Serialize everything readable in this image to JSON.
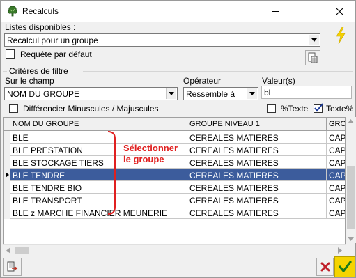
{
  "window": {
    "title": "Recalculs"
  },
  "listes": {
    "label": "Listes disponibles :",
    "selected": "Recalcul pour un groupe",
    "default_query_label": "Requête par défaut"
  },
  "criteria": {
    "group_label": "Critères de filtre",
    "field_label": "Sur le champ",
    "field_value": "NOM DU GROUPE",
    "operator_label": "Opérateur",
    "operator_value": "Ressemble à",
    "value_label": "Valeur(s)",
    "value_text": "bl",
    "case_label": "Différencier Minuscules / Majuscules",
    "pct_text_label": "%Texte",
    "text_pct_label": "Texte%",
    "text_pct_checked": true
  },
  "grid": {
    "columns": [
      "NOM DU GROUPE",
      "GROUPE NIVEAU 1",
      "GRO"
    ],
    "rows": [
      [
        "BLE",
        "CEREALES MATIERES",
        "CAP"
      ],
      [
        "BLE PRESTATION",
        "CEREALES MATIERES",
        "CAP"
      ],
      [
        "BLE STOCKAGE TIERS",
        "CEREALES MATIERES",
        "CAP"
      ],
      [
        "BLE TENDRE",
        "CEREALES MATIERES",
        "CAP"
      ],
      [
        "BLE TENDRE BIO",
        "CEREALES MATIERES",
        "CAP"
      ],
      [
        "BLE TRANSPORT",
        "CEREALES MATIERES",
        "CAP"
      ],
      [
        "BLE z MARCHE FINANCIER MEUNERIE",
        "CEREALES MATIERES",
        "CAP"
      ]
    ],
    "selected_row": 3
  },
  "annotation": {
    "line1": "Sélectionner",
    "line2": "le groupe",
    "color": "#e02020"
  },
  "colors": {
    "selection": "#3c5c9c",
    "accent_bolt": "#f5d000",
    "cancel": "#c0202a",
    "ok": "#f5d400"
  },
  "icons": {
    "app": "tree-icon",
    "bolt": "lightning-icon",
    "export": "export-icon",
    "cancel": "cancel-x-icon",
    "ok": "checkmark-icon"
  }
}
